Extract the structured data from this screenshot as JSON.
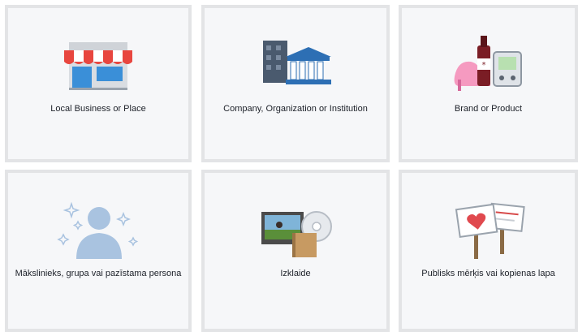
{
  "categories": [
    {
      "label": "Local Business or Place",
      "icon": "storefront-icon"
    },
    {
      "label": "Company, Organization or Institution",
      "icon": "company-building-icon"
    },
    {
      "label": "Brand or Product",
      "icon": "brand-product-icon"
    },
    {
      "label": "Mākslinieks, grupa vai pazīstama persona",
      "icon": "artist-person-icon"
    },
    {
      "label": "Izklaide",
      "icon": "entertainment-icon"
    },
    {
      "label": "Publisks mērķis vai kopienas lapa",
      "icon": "cause-community-icon"
    }
  ]
}
